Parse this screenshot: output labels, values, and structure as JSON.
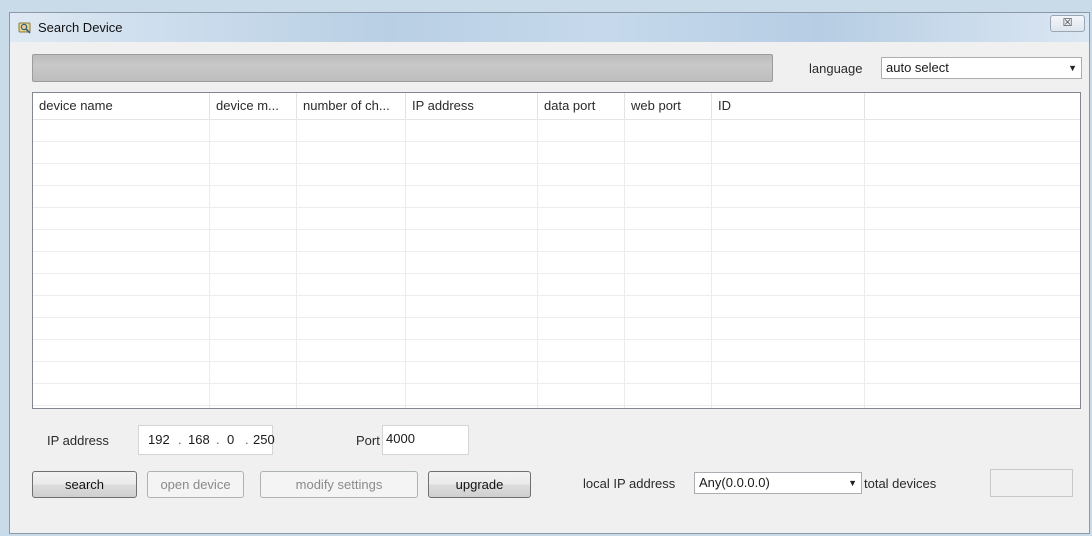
{
  "window": {
    "title": "Search Device",
    "close_glyph": "☒"
  },
  "progress": {
    "fraction": 0
  },
  "language": {
    "label": "language",
    "selected": "auto select"
  },
  "table": {
    "columns": [
      "device name",
      "device m...",
      "number of ch...",
      "IP address",
      "data port",
      "web port",
      "ID",
      ""
    ],
    "rows": []
  },
  "ip": {
    "label": "IP address",
    "octets": [
      "192",
      "168",
      "0",
      "250"
    ]
  },
  "port": {
    "label": "Port",
    "value": "4000"
  },
  "buttons": {
    "search": "search",
    "open_device": "open device",
    "modify_settings": "modify settings",
    "upgrade": "upgrade"
  },
  "local_ip": {
    "label": "local IP address",
    "selected": "Any(0.0.0.0)"
  },
  "total_devices": {
    "label": "total devices",
    "value": ""
  }
}
